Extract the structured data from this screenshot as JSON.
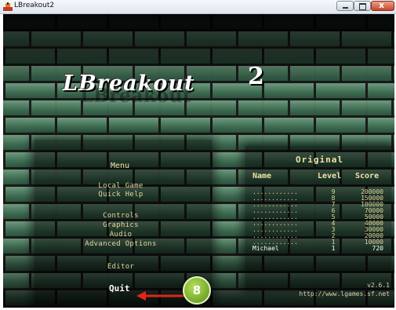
{
  "window": {
    "title": "LBreakout2",
    "close_glyph": "x"
  },
  "logo": {
    "text": "LBreakout",
    "superscript": "2"
  },
  "menu": {
    "title": "Menu",
    "items": [
      "Local Game",
      "Quick Help",
      "Controls",
      "Graphics",
      "Audio",
      "Advanced Options",
      "Editor"
    ],
    "quit": "Quit"
  },
  "highscores": {
    "title": "Original",
    "columns": {
      "name": "Name",
      "level": "Level",
      "score": "Score"
    },
    "rows": [
      {
        "name": "............",
        "level": "9",
        "score": "200000"
      },
      {
        "name": "............",
        "level": "8",
        "score": "150000"
      },
      {
        "name": "............",
        "level": "7",
        "score": "100000"
      },
      {
        "name": "............",
        "level": "6",
        "score": "70000"
      },
      {
        "name": "............",
        "level": "5",
        "score": "50000"
      },
      {
        "name": "............",
        "level": "4",
        "score": "40000"
      },
      {
        "name": "............",
        "level": "3",
        "score": "30000"
      },
      {
        "name": "............",
        "level": "2",
        "score": "20000"
      },
      {
        "name": "............",
        "level": "1",
        "score": "10000"
      },
      {
        "name": "Michael",
        "level": "1",
        "score": "720"
      }
    ]
  },
  "footer": {
    "version": "v2.6.1",
    "url": "http://www.lgames.sf.net"
  },
  "annotation": {
    "badge": "8",
    "arrow_color": "#e0261e",
    "badge_color": "#7fb534"
  },
  "colors": {
    "menu_text": "#e3d79a",
    "brick": "#4f7d60"
  },
  "icons": {
    "app": "app-icon",
    "minimize": "minimize-icon",
    "maximize": "maximize-icon",
    "close": "close-icon"
  }
}
